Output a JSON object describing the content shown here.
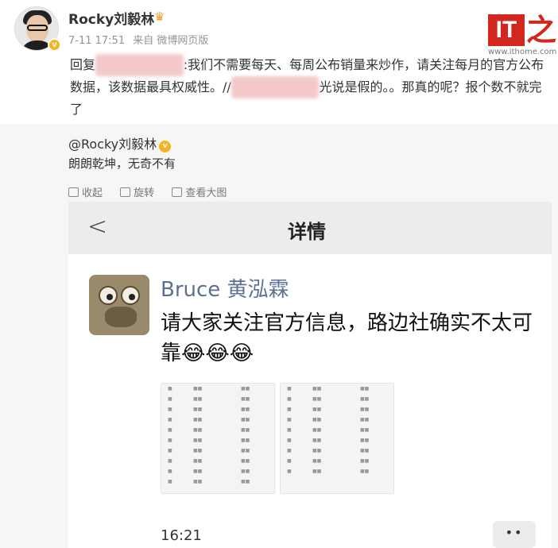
{
  "post": {
    "username": "Rocky刘毅林",
    "crown_icon": "crown-icon",
    "verified_mark": "v",
    "time": "7-11 17:51",
    "source": "来自 微博网页版",
    "reply_prefix": "回复",
    "reply_text_1": ":我们不需要每天、每周公布销量来炒作，请关注每月的官方公布数据，该数据最具权威性。//",
    "reply_text_2": "光说是假的。。那真的呢？报个数不就完了"
  },
  "logo": {
    "it": "IT",
    "zhi": "之家",
    "url": "www.ithome.com"
  },
  "repost": {
    "username": "@Rocky刘毅林",
    "verified_mark": "v",
    "text": "朗朗乾坤，无奇不有",
    "actions": [
      {
        "label": "收起",
        "icon": "collapse-icon"
      },
      {
        "label": "旋转",
        "icon": "rotate-icon"
      },
      {
        "label": "查看大图",
        "icon": "view-large-icon"
      }
    ]
  },
  "screenshot": {
    "back": "<",
    "title": "详情",
    "sender": "Bruce 黄泓霖",
    "message": "请大家关注官方信息，路边社确实不太可靠😂😂😂",
    "time": "16:21",
    "more": "••"
  }
}
